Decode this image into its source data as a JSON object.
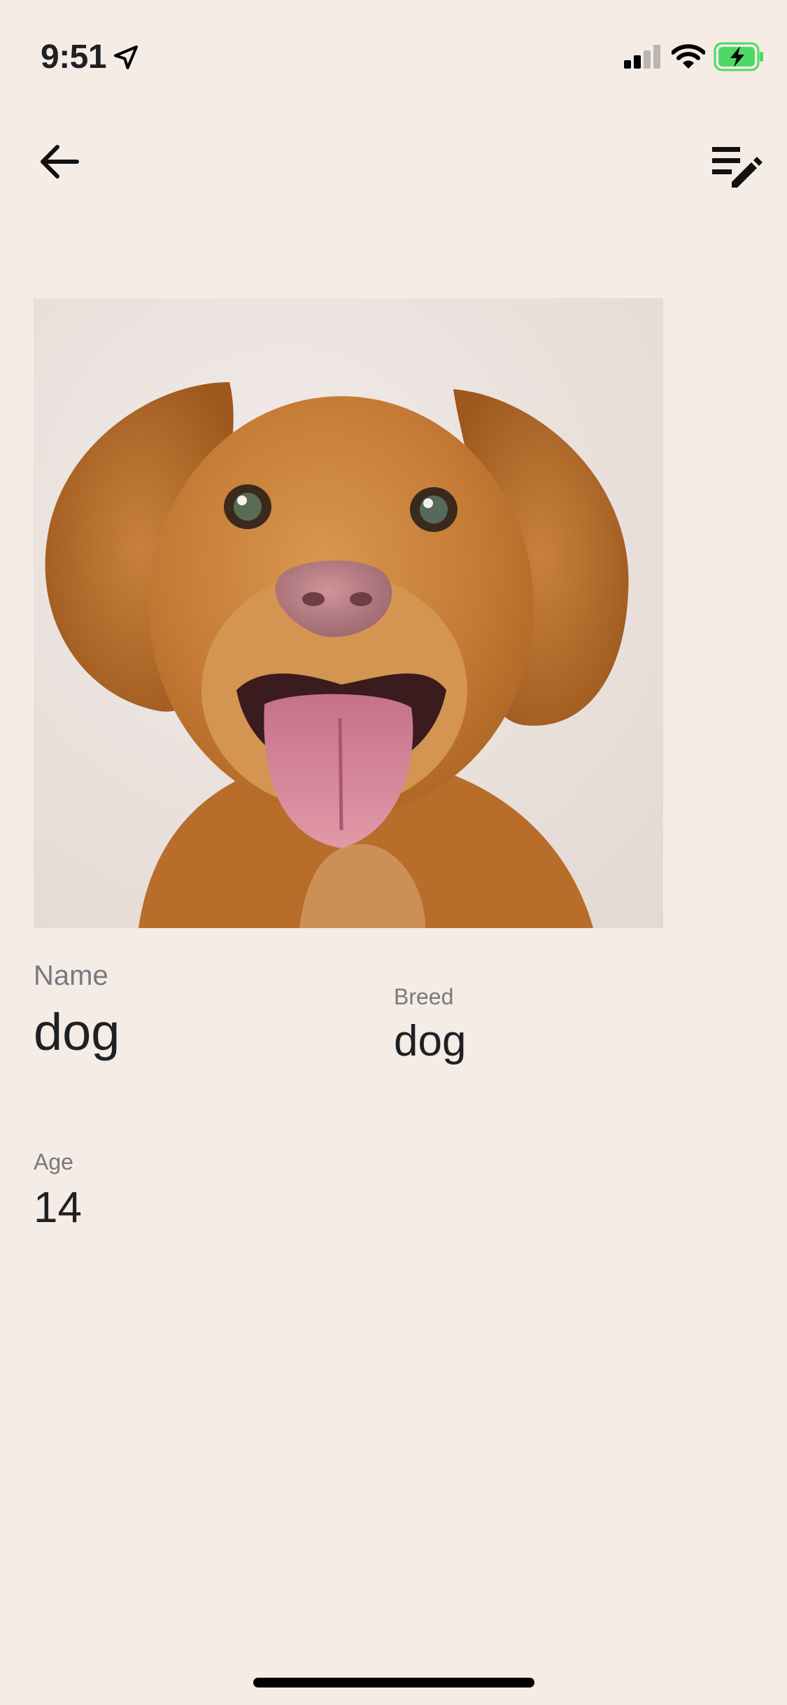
{
  "status_bar": {
    "time": "9:51",
    "icons": [
      "location-arrow-icon",
      "cellular-signal-icon",
      "wifi-icon",
      "battery-charging-icon"
    ],
    "battery_color": "#4cd964"
  },
  "toolbar": {
    "back_icon": "arrow-left-icon",
    "edit_icon": "list-edit-icon"
  },
  "pet": {
    "photo": "dog-photo",
    "fields": {
      "name": {
        "label": "Name",
        "value": "dog"
      },
      "breed": {
        "label": "Breed",
        "value": "dog"
      },
      "age": {
        "label": "Age",
        "value": "14"
      }
    }
  },
  "colors": {
    "background": "#f4ece5",
    "text": "#1f2024",
    "label": "#777a7e"
  }
}
